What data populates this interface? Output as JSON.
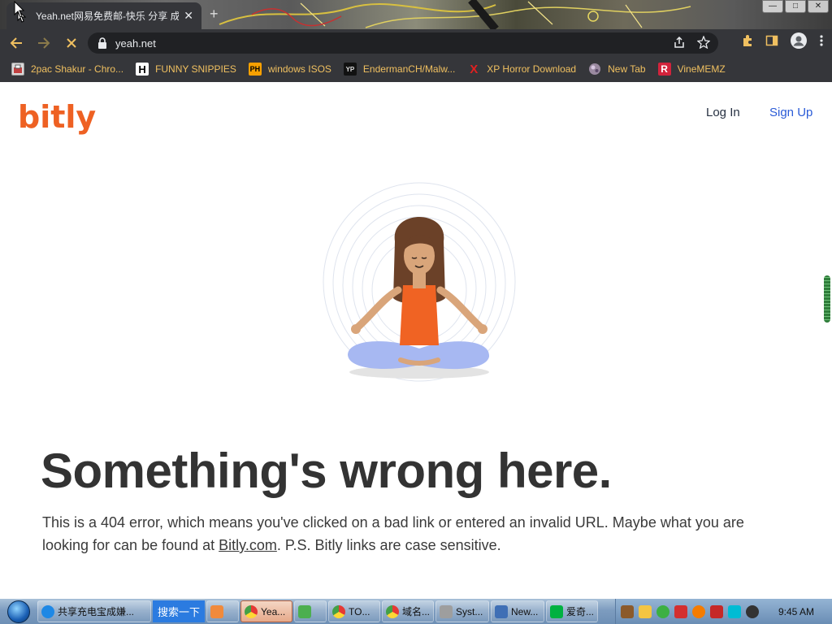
{
  "browser": {
    "tab_title": "Yeah.net网易免费邮-快乐 分享 成",
    "tab_close": "✕",
    "new_tab": "+",
    "url": "yeah.net",
    "bookmarks": [
      {
        "label": "2pac Shakur - Chro...",
        "icon": "app-icon"
      },
      {
        "label": "FUNNY SNIPPIES",
        "icon": "h-icon",
        "glyph": "H"
      },
      {
        "label": "windows ISOS",
        "icon": "ph-icon",
        "glyph": "PH"
      },
      {
        "label": "EndermanCH/Malw...",
        "icon": "yp-icon",
        "glyph": "YP"
      },
      {
        "label": "XP Horror Download",
        "icon": "x-icon",
        "glyph": "X"
      },
      {
        "label": "New Tab",
        "icon": "globe-icon"
      },
      {
        "label": "VineMEMZ",
        "icon": "r-icon",
        "glyph": "R"
      }
    ]
  },
  "site": {
    "logo": "bitly",
    "nav": {
      "login": "Log In",
      "signup": "Sign Up"
    },
    "heading": "Something's wrong here.",
    "body_before": "This is a 404 error, which means you've clicked on a bad link or entered an invalid URL. Maybe what you are looking for can be found at ",
    "body_link": "Bitly.com",
    "body_after": ". P.S. Bitly links are case sensitive."
  },
  "taskbar": {
    "items": [
      {
        "label": "共享充电宝成嫌...",
        "icon": "ie-icon",
        "active": false
      },
      {
        "label": "搜索一下",
        "icon": "search",
        "active": false
      },
      {
        "label": "",
        "icon": "app-icon",
        "active": false
      },
      {
        "label": "Yea...",
        "icon": "chrome-icon",
        "active": true
      },
      {
        "label": "",
        "icon": "app-icon",
        "active": false
      },
      {
        "label": "TO...",
        "icon": "chrome-icon",
        "active": false
      },
      {
        "label": "域名...",
        "icon": "chrome-icon",
        "active": false
      },
      {
        "label": "Syst...",
        "icon": "system-icon",
        "active": false
      },
      {
        "label": "New...",
        "icon": "shield-icon",
        "active": false
      },
      {
        "label": "爱奇...",
        "icon": "iqiyi-icon",
        "active": false
      }
    ],
    "clock": "9:45 AM"
  },
  "colors": {
    "bitly_orange": "#ee6123",
    "signup_blue": "#2a5bd7",
    "bookmark_text": "#f0c060",
    "chrome_dark": "#35363a"
  }
}
